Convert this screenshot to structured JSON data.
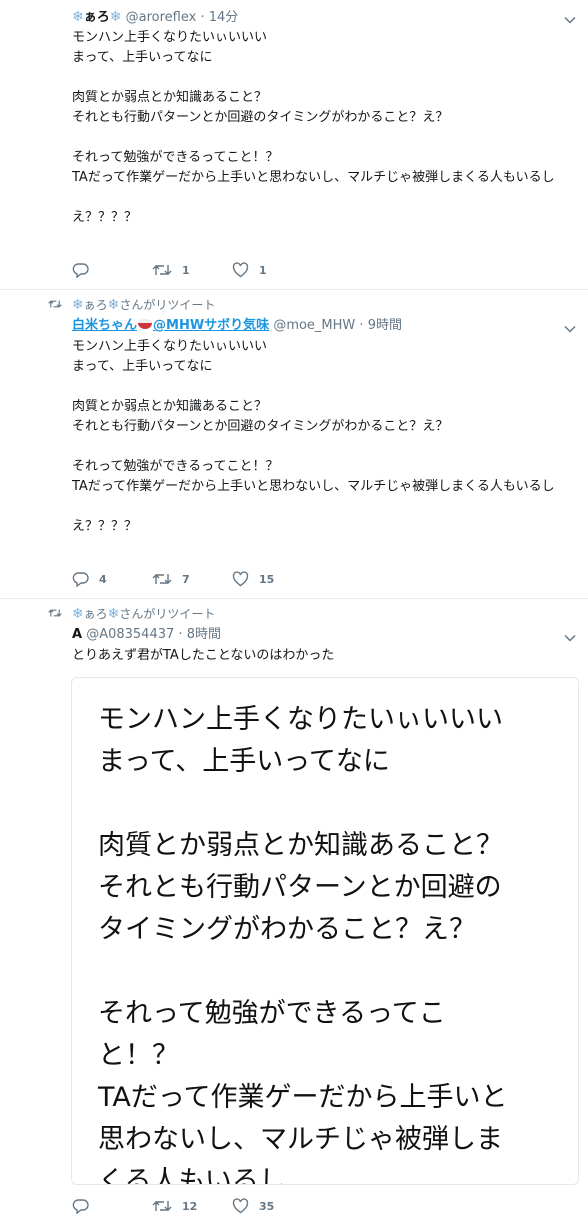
{
  "tweets": [
    {
      "name": "ぁろ",
      "handle": "@aroreflex",
      "sep": "·",
      "time": "14分",
      "text": "モンハン上手くなりたいぃいいい\nまって、上手いってなに\n\n肉質とか弱点とか知識あること？\nそれとも行動パターンとか回避のタイミングがわかること？え？\n\nそれって勉強ができるってこと！？\nTAだって作業ゲーだから上手いと思わないし、マルチじゃ被弾しまくる人もいるし\n\nえ？？？？",
      "reply_count": "",
      "retweet_count": "1",
      "like_count": "1"
    },
    {
      "retweeted_by": "ぁろ",
      "retweeted_label": "さんがリツイート",
      "name": "白米ちゃん",
      "name_suffix": "@MHWサボり気味",
      "handle": "@moe_MHW",
      "sep": "·",
      "time": "9時間",
      "text": "モンハン上手くなりたいぃいいい\nまって、上手いってなに\n\n肉質とか弱点とか知識あること？\nそれとも行動パターンとか回避のタイミングがわかること？え？\n\nそれって勉強ができるってこと！？\nTAだって作業ゲーだから上手いと思わないし、マルチじゃ被弾しまくる人もいるし\n\nえ？？？？",
      "reply_count": "4",
      "retweet_count": "7",
      "like_count": "15"
    },
    {
      "retweeted_by": "ぁろ",
      "retweeted_label": "さんがリツイート",
      "name": "A",
      "handle": "@A08354437",
      "sep": "·",
      "time": "8時間",
      "text": "とりあえず君がTAしたことないのはわかった",
      "card_text": "モンハン上手くなりたいぃいいい\nまって、上手いってなに\n\n肉質とか弱点とか知識あること？\nそれとも行動パターンとか回避の\nタイミングがわかること？え？\n\nそれって勉強ができるってこ\nと！？\nTAだって作業ゲーだから上手いと\n思わないし、マルチじゃ被弾しま\nくる人もいるし\n\nえ？？？？",
      "reply_count": "",
      "retweet_count": "12",
      "like_count": "35"
    }
  ],
  "icons": {
    "snowflake": "❄",
    "retweet": "retweet-icon",
    "reply": "reply-icon",
    "like": "heart-icon",
    "caret": "chevron-down-icon",
    "bowl": "rice-bowl-icon"
  },
  "colors": {
    "link": "#1b95e0",
    "muted": "#657786",
    "border": "#e6ecf0",
    "snowflake": "#7fb2dd",
    "bowl_red": "#d0343b"
  }
}
